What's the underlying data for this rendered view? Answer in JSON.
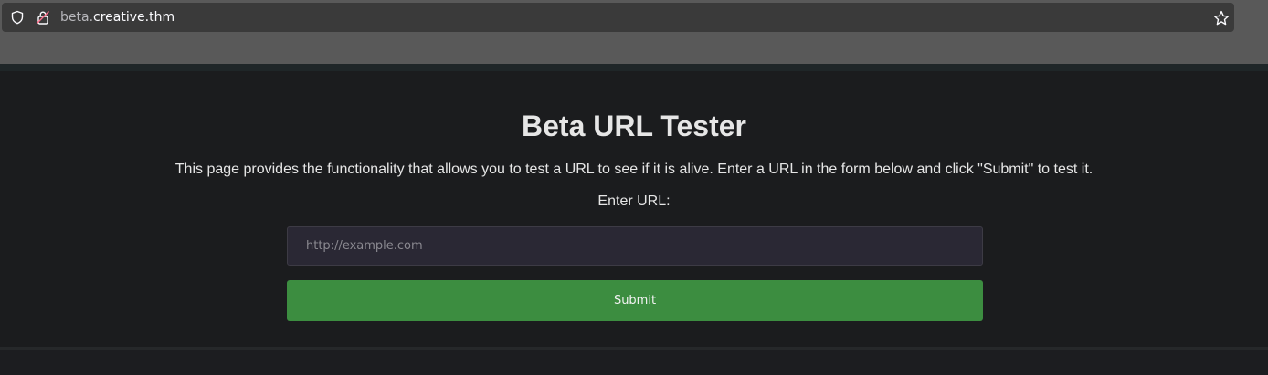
{
  "browser": {
    "url_subdomain": "beta.",
    "url_domain": "creative.thm",
    "icons": {
      "tracking_protection": "shield-icon",
      "connection": "lock-icon",
      "bookmark": "star-icon"
    }
  },
  "page": {
    "title": "Beta URL Tester",
    "description": "This page provides the functionality that allows you to test a URL to see if it is alive. Enter a URL in the form below and click \"Submit\" to test it.",
    "form": {
      "label": "Enter URL:",
      "input_value": "",
      "input_placeholder": "http://example.com",
      "submit_label": "Submit"
    }
  },
  "colors": {
    "content_background": "#1b1c1e",
    "text": "#e6e6e6",
    "input_background": "#2a2834",
    "submit_button": "#3c8d40"
  }
}
